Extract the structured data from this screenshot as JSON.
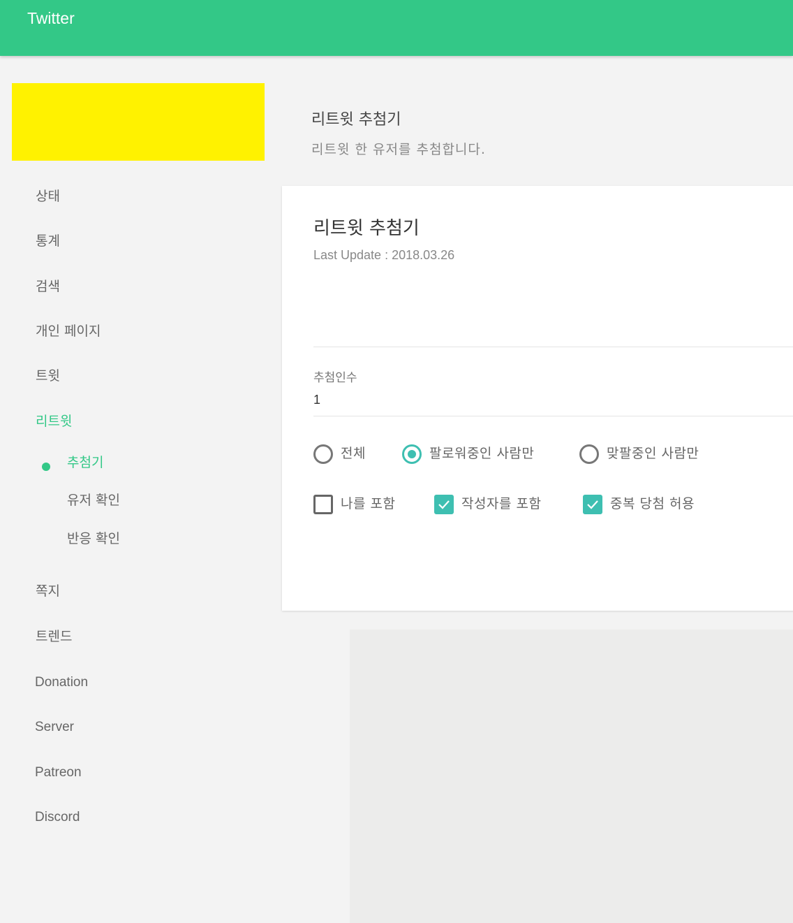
{
  "header": {
    "title": "Twitter"
  },
  "sidebar": {
    "items": [
      {
        "label": "상태"
      },
      {
        "label": "통계"
      },
      {
        "label": "검색"
      },
      {
        "label": "개인 페이지"
      },
      {
        "label": "트윗"
      },
      {
        "label": "리트윗",
        "active": true
      },
      {
        "label": "쪽지"
      },
      {
        "label": "트렌드"
      },
      {
        "label": "Donation"
      },
      {
        "label": "Server"
      },
      {
        "label": "Patreon"
      },
      {
        "label": "Discord"
      }
    ],
    "subitems": [
      {
        "label": "추첨기",
        "active": true
      },
      {
        "label": "유저 확인"
      },
      {
        "label": "반응 확인"
      }
    ]
  },
  "page": {
    "heading": "리트윗 추첨기",
    "subheading": "리트윗 한 유저를 추첨합니다."
  },
  "card": {
    "title": "리트윗 추첨기",
    "last_update": "Last Update : 2018.03.26",
    "winners_label": "추첨인수",
    "winners_value": "1",
    "scope_options": [
      {
        "label": "전체",
        "selected": false
      },
      {
        "label": "팔로워중인 사람만",
        "selected": true
      },
      {
        "label": "맞팔중인 사람만",
        "selected": false
      }
    ],
    "flags": [
      {
        "label": "나를 포함",
        "checked": false
      },
      {
        "label": "작성자를 포함",
        "checked": true
      },
      {
        "label": "중복 당첨 허용",
        "checked": true
      }
    ]
  },
  "colors": {
    "accent": "#33c887",
    "control": "#3ebfb1",
    "highlight": "#fff200"
  }
}
